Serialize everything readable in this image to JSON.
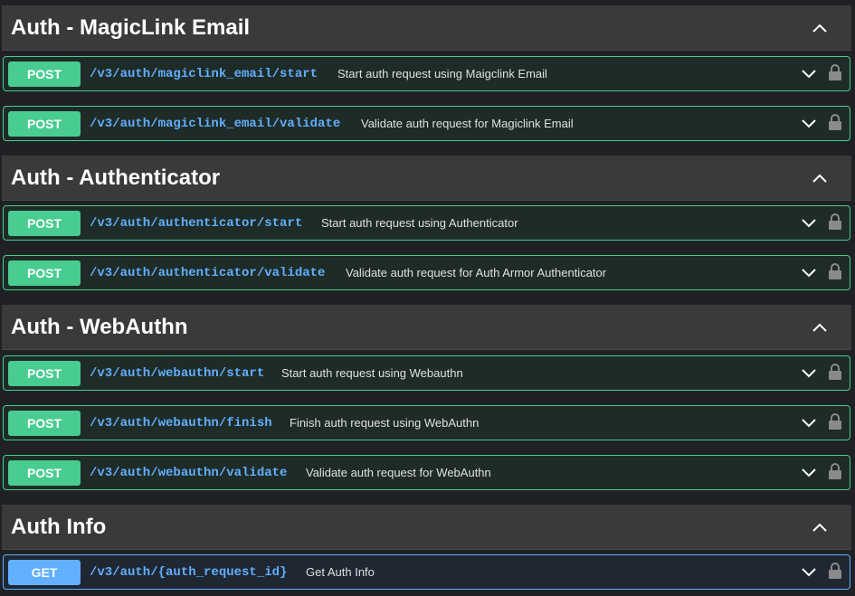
{
  "sections": [
    {
      "title": "Auth - MagicLink Email",
      "operations": [
        {
          "method": "POST",
          "path": "/v3/auth/magiclink_email/start",
          "summary": "Start auth request using Maigclink Email"
        },
        {
          "method": "POST",
          "path": "/v3/auth/magiclink_email/validate",
          "summary": "Validate auth request for Magiclink Email"
        }
      ]
    },
    {
      "title": "Auth - Authenticator",
      "operations": [
        {
          "method": "POST",
          "path": "/v3/auth/authenticator/start",
          "summary": "Start auth request using Authenticator"
        },
        {
          "method": "POST",
          "path": "/v3/auth/authenticator/validate",
          "summary": "Validate auth request for Auth Armor Authenticator"
        }
      ]
    },
    {
      "title": "Auth - WebAuthn",
      "operations": [
        {
          "method": "POST",
          "path": "/v3/auth/webauthn/start",
          "summary": "Start auth request using Webauthn"
        },
        {
          "method": "POST",
          "path": "/v3/auth/webauthn/finish",
          "summary": "Finish auth request using WebAuthn"
        },
        {
          "method": "POST",
          "path": "/v3/auth/webauthn/validate",
          "summary": "Validate auth request for WebAuthn"
        }
      ]
    },
    {
      "title": "Auth Info",
      "operations": [
        {
          "method": "GET",
          "path": "/v3/auth/{auth_request_id}",
          "summary": "Get Auth Info"
        }
      ]
    }
  ],
  "colors": {
    "post": "#49cc90",
    "get": "#61affe",
    "path": "#61affe",
    "header_bg": "#3a3a3a",
    "page_bg": "#1f2124"
  },
  "icons": {
    "section_toggle": "chevron-up-icon",
    "operation_toggle": "chevron-down-icon",
    "auth": "lock-icon"
  }
}
